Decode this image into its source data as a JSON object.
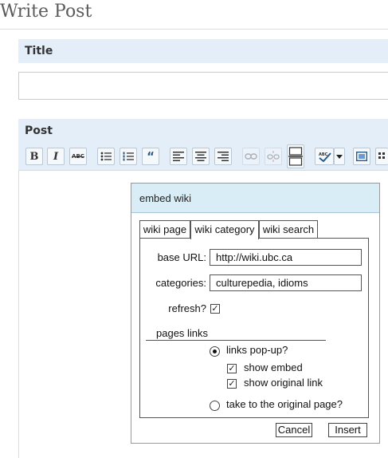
{
  "page": {
    "title": "Write Post"
  },
  "title_section": {
    "heading": "Title",
    "value": ""
  },
  "post_section": {
    "heading": "Post",
    "toolbar": [
      {
        "name": "bold-button",
        "glyph": "B",
        "icon": "bold-icon"
      },
      {
        "name": "italic-button",
        "glyph": "I",
        "icon": "italic-icon"
      },
      {
        "name": "strikethrough-button",
        "glyph": "ABC",
        "icon": "strikethrough-icon"
      },
      {
        "name": "bullet-list-button",
        "icon": "bullet-list-icon"
      },
      {
        "name": "numbered-list-button",
        "icon": "numbered-list-icon"
      },
      {
        "name": "blockquote-button",
        "glyph": "“",
        "icon": "blockquote-icon"
      },
      {
        "name": "align-left-button",
        "icon": "align-left-icon"
      },
      {
        "name": "align-center-button",
        "icon": "align-center-icon"
      },
      {
        "name": "align-right-button",
        "icon": "align-right-icon"
      },
      {
        "name": "link-button",
        "icon": "link-icon"
      },
      {
        "name": "unlink-button",
        "icon": "unlink-icon"
      },
      {
        "name": "more-button",
        "icon": "page-break-icon"
      },
      {
        "name": "spellcheck-button",
        "glyph": "ABC",
        "icon": "spellcheck-icon"
      },
      {
        "name": "fullscreen-button",
        "icon": "fullscreen-icon"
      },
      {
        "name": "kitchen-sink-button",
        "icon": "kitchen-sink-icon"
      }
    ]
  },
  "dialog": {
    "title": "embed wiki",
    "tabs": [
      "wiki page",
      "wiki category",
      "wiki search"
    ],
    "active_tab": "wiki category",
    "base_url_label": "base URL:",
    "base_url_value": "http://wiki.ubc.ca",
    "categories_label": "categories:",
    "categories_value": "culturepedia, idioms",
    "refresh_label": "refresh?",
    "refresh_checked": true,
    "pages_links_label": "pages links",
    "links_popup_label": "links pop-up?",
    "links_popup_selected": true,
    "show_embed_label": "show embed",
    "show_embed_checked": true,
    "show_original_label": "show original link",
    "show_original_checked": true,
    "take_original_label": "take to the original page?",
    "take_original_selected": false,
    "cancel_label": "Cancel",
    "insert_label": "Insert"
  },
  "colors": {
    "section_bg": "#e4eef8",
    "dialog_head_bg": "#d9edf7"
  }
}
